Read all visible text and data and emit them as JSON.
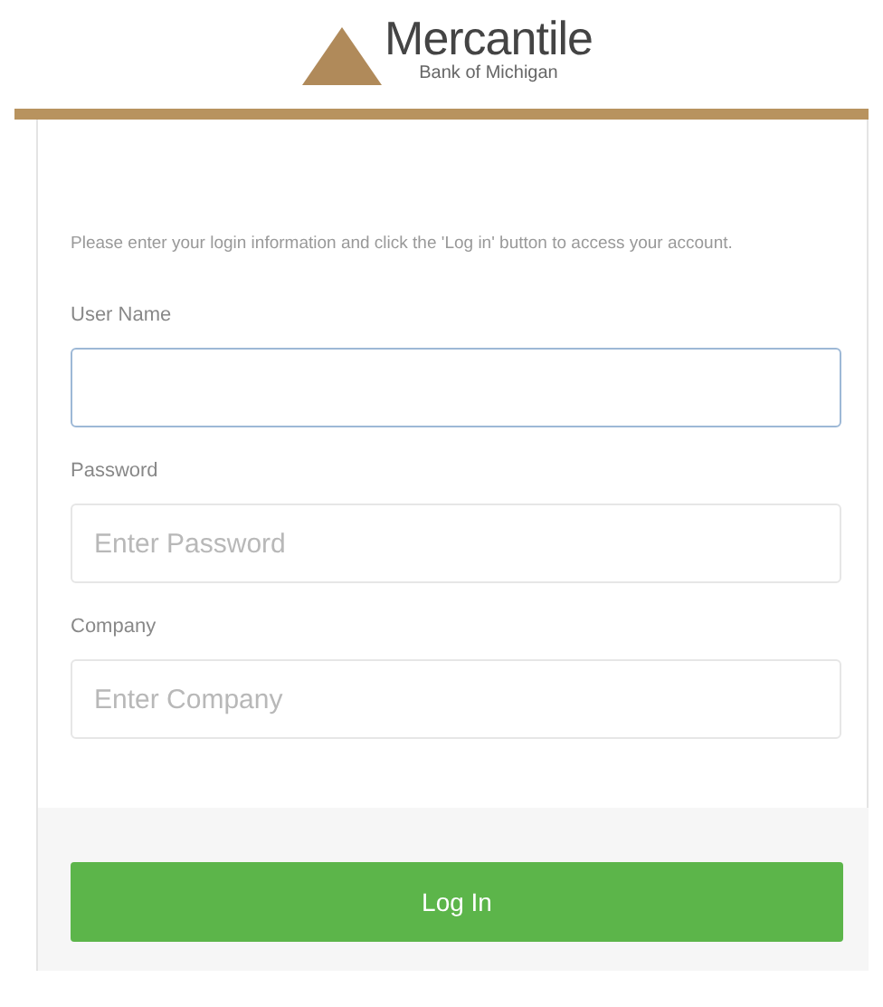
{
  "logo": {
    "name": "Mercantile",
    "tagline": "Bank of Michigan"
  },
  "intro": "Please enter your login information and click the 'Log in' button to access your account.",
  "fields": [
    {
      "label": "User Name",
      "focused": true
    },
    {
      "label": "Password",
      "placeholder": "Enter Password",
      "focused": false
    },
    {
      "label": "Company",
      "placeholder": "Enter Company",
      "focused": false
    }
  ],
  "submit": "Log In"
}
